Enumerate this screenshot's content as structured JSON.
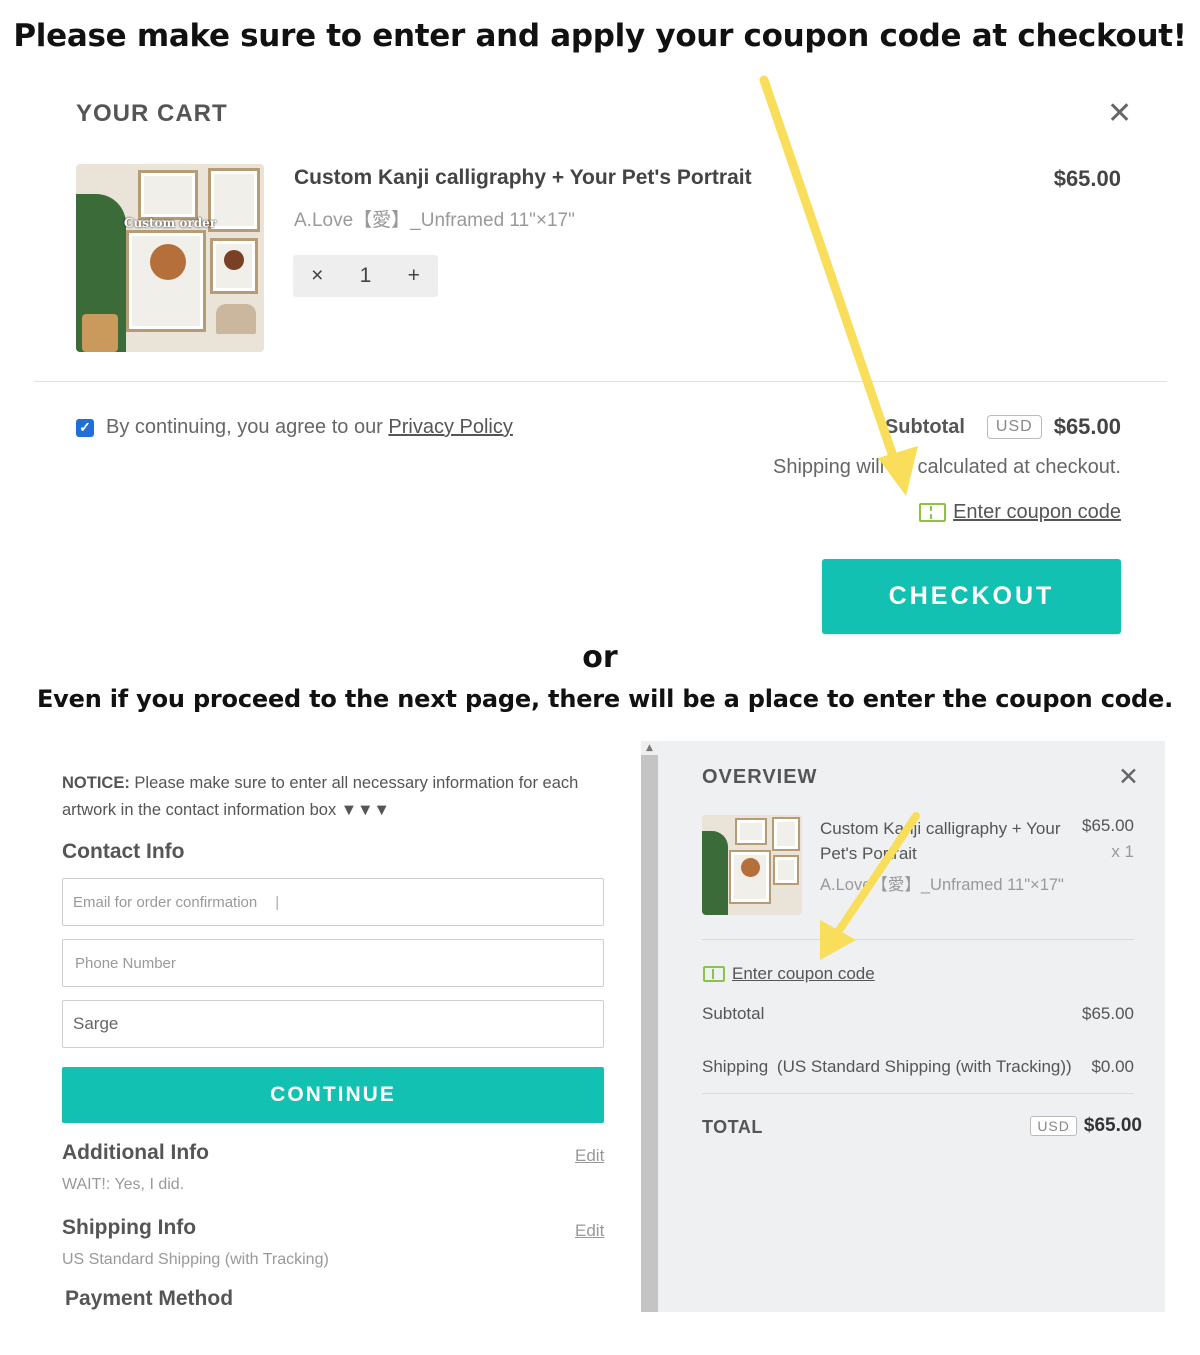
{
  "headline": "Please make sure to enter and apply your coupon code at checkout!",
  "cart": {
    "title": "YOUR CART",
    "item": {
      "thumb_label": "Custom order",
      "name": "Custom Kanji calligraphy + Your Pet's Portrait",
      "variant": "A.Love【愛】_Unframed 11\"×17\"",
      "price": "$65.00",
      "qty_minus": "×",
      "qty": "1",
      "qty_plus": "+"
    },
    "agree_text": "By continuing, you agree to our ",
    "privacy_link": "Privacy Policy",
    "subtotal_label": "Subtotal",
    "currency": "USD",
    "subtotal_value": "$65.00",
    "shipping_note": "Shipping will be calculated at checkout.",
    "coupon_link": "Enter coupon code",
    "checkout_label": "CHECKOUT"
  },
  "or_text": "or",
  "sub_headline": "Even if you proceed to the next page, there will be a place to enter the coupon code.",
  "checkout_page": {
    "notice_bold": "NOTICE:",
    "notice_text": " Please make sure to enter all necessary information for each artwork in the contact information box ▼▼▼",
    "contact_heading": "Contact Info",
    "email_placeholder": "Email for order confirmation",
    "phone_placeholder": "Phone Number",
    "name_value": "Sarge",
    "continue_label": "CONTINUE",
    "additional_heading": "Additional Info",
    "additional_edit": "Edit",
    "additional_value": "WAIT!: Yes, I did.",
    "shipping_heading": "Shipping Info",
    "shipping_edit": "Edit",
    "shipping_value": "US Standard Shipping (with Tracking)",
    "payment_heading": "Payment Method"
  },
  "overview": {
    "title": "OVERVIEW",
    "item_name_line1": "Custom Kanji calligraphy + Your",
    "item_name_line2": "Pet's Portrait",
    "item_price": "$65.00",
    "item_qty": "x 1",
    "item_variant": "A.Love【愛】_Unframed 11\"×17\"",
    "coupon_link": "Enter coupon code",
    "subtotal_label": "Subtotal",
    "subtotal_value": "$65.00",
    "shipping_label": "Shipping",
    "shipping_method": "(US Standard Shipping (with Tracking))",
    "shipping_value": "$0.00",
    "total_label": "TOTAL",
    "currency": "USD",
    "total_value": "$65.00"
  },
  "colors": {
    "accent": "#13c1b3",
    "arrow": "#f8de5b",
    "coupon_icon": "#8bc34a",
    "checkbox": "#1f6fd6"
  },
  "icons": [
    "close-icon",
    "checkbox-checked-icon",
    "coupon-ticket-icon",
    "scroll-up-icon",
    "yellow-arrow"
  ]
}
